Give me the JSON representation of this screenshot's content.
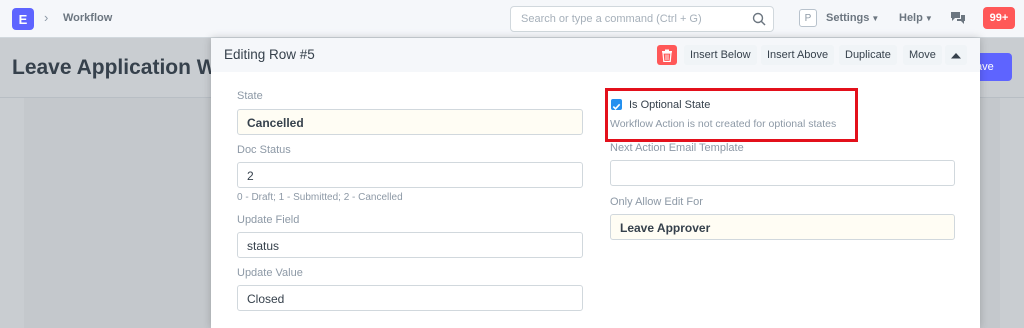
{
  "navbar": {
    "logo_letter": "E",
    "breadcrumb": "Workflow",
    "search_placeholder": "Search or type a command (Ctrl + G)",
    "profile_letter": "P",
    "settings_label": "Settings",
    "help_label": "Help",
    "notifications_count": "99+"
  },
  "background": {
    "page_title": "Leave Application Wo",
    "save_label": "ave"
  },
  "modal": {
    "title": "Editing Row #5",
    "buttons": {
      "insert_below": "Insert Below",
      "insert_above": "Insert Above",
      "duplicate": "Duplicate",
      "move": "Move"
    },
    "left": {
      "state_label": "State",
      "state_value": "Cancelled",
      "doc_status_label": "Doc Status",
      "doc_status_value": "2",
      "doc_status_help": "0 - Draft; 1 - Submitted; 2 - Cancelled",
      "update_field_label": "Update Field",
      "update_field_value": "status",
      "update_value_label": "Update Value",
      "update_value_value": "Closed"
    },
    "right": {
      "is_optional_label": "Is Optional State",
      "is_optional_checked": true,
      "is_optional_help": "Workflow Action is not created for optional states",
      "next_action_label": "Next Action Email Template",
      "next_action_value": "",
      "only_allow_edit_label": "Only Allow Edit For",
      "only_allow_edit_value": "Leave Approver"
    }
  },
  "colors": {
    "brand": "#5e64ff",
    "danger": "#ff5858",
    "checkbox": "#2490ef",
    "highlight": "#e3101b"
  }
}
